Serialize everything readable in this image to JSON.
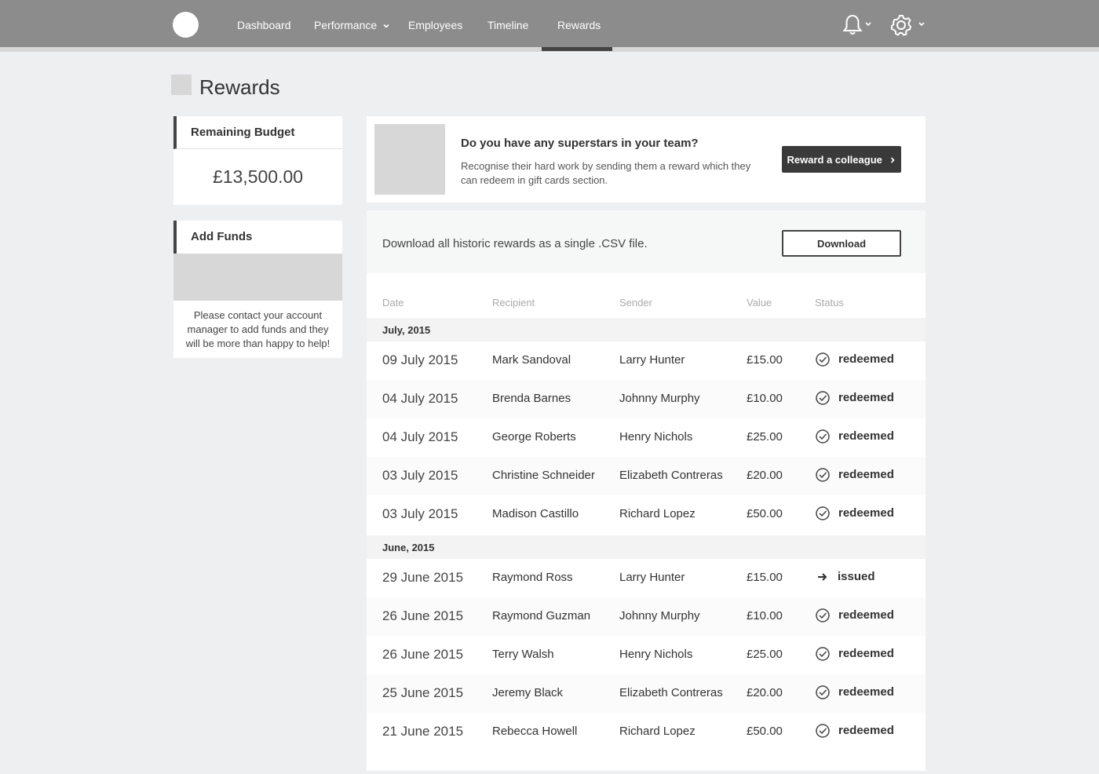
{
  "nav": {
    "items": [
      "Dashboard",
      "Performance",
      "Employees",
      "Timeline",
      "Rewards"
    ],
    "active": "Rewards"
  },
  "page": {
    "title": "Rewards"
  },
  "sidebar": {
    "budget_title": "Remaining Budget",
    "budget_value": "£13,500.00",
    "funds_title": "Add Funds",
    "funds_text": "Please contact your account manager to add funds and they will be more than happy to help!"
  },
  "promo": {
    "title": "Do you have any superstars in your team?",
    "description": "Recognise their hard work by sending them a reward which they can redeem in gift cards section.",
    "button": "Reward a colleague"
  },
  "download": {
    "text": "Download all historic rewards as a single .CSV file.",
    "button": "Download"
  },
  "table": {
    "headers": [
      "Date",
      "Recipient",
      "Sender",
      "Value",
      "Status"
    ],
    "groups": [
      {
        "label": "July, 2015",
        "rows": [
          {
            "date": "09 July 2015",
            "recipient": "Mark Sandoval",
            "sender": "Larry Hunter",
            "value": "£15.00",
            "status": "redeemed"
          },
          {
            "date": "04 July 2015",
            "recipient": "Brenda Barnes",
            "sender": "Johnny Murphy",
            "value": "£10.00",
            "status": "redeemed"
          },
          {
            "date": "04 July 2015",
            "recipient": "George Roberts",
            "sender": "Henry Nichols",
            "value": "£25.00",
            "status": "redeemed"
          },
          {
            "date": "03 July 2015",
            "recipient": "Christine Schneider",
            "sender": "Elizabeth Contreras",
            "value": "£20.00",
            "status": "redeemed"
          },
          {
            "date": "03 July 2015",
            "recipient": "Madison Castillo",
            "sender": "Richard Lopez",
            "value": "£50.00",
            "status": "redeemed"
          }
        ]
      },
      {
        "label": "June, 2015",
        "rows": [
          {
            "date": "29 June 2015",
            "recipient": "Raymond Ross",
            "sender": "Larry Hunter",
            "value": "£15.00",
            "status": "issued"
          },
          {
            "date": "26 June 2015",
            "recipient": "Raymond Guzman",
            "sender": "Johnny Murphy",
            "value": "£10.00",
            "status": "redeemed"
          },
          {
            "date": "26 June 2015",
            "recipient": "Terry Walsh",
            "sender": "Henry Nichols",
            "value": "£25.00",
            "status": "redeemed"
          },
          {
            "date": "25 June 2015",
            "recipient": "Jeremy Black",
            "sender": "Elizabeth Contreras",
            "value": "£20.00",
            "status": "redeemed"
          },
          {
            "date": "21 June 2015",
            "recipient": "Rebecca Howell",
            "sender": "Richard Lopez",
            "value": "£50.00",
            "status": "redeemed"
          }
        ]
      }
    ]
  },
  "icons": {
    "notifications": "bell-icon",
    "settings": "gear-icon",
    "redeemed": "check-circle-icon",
    "issued": "arrow-right-icon"
  }
}
